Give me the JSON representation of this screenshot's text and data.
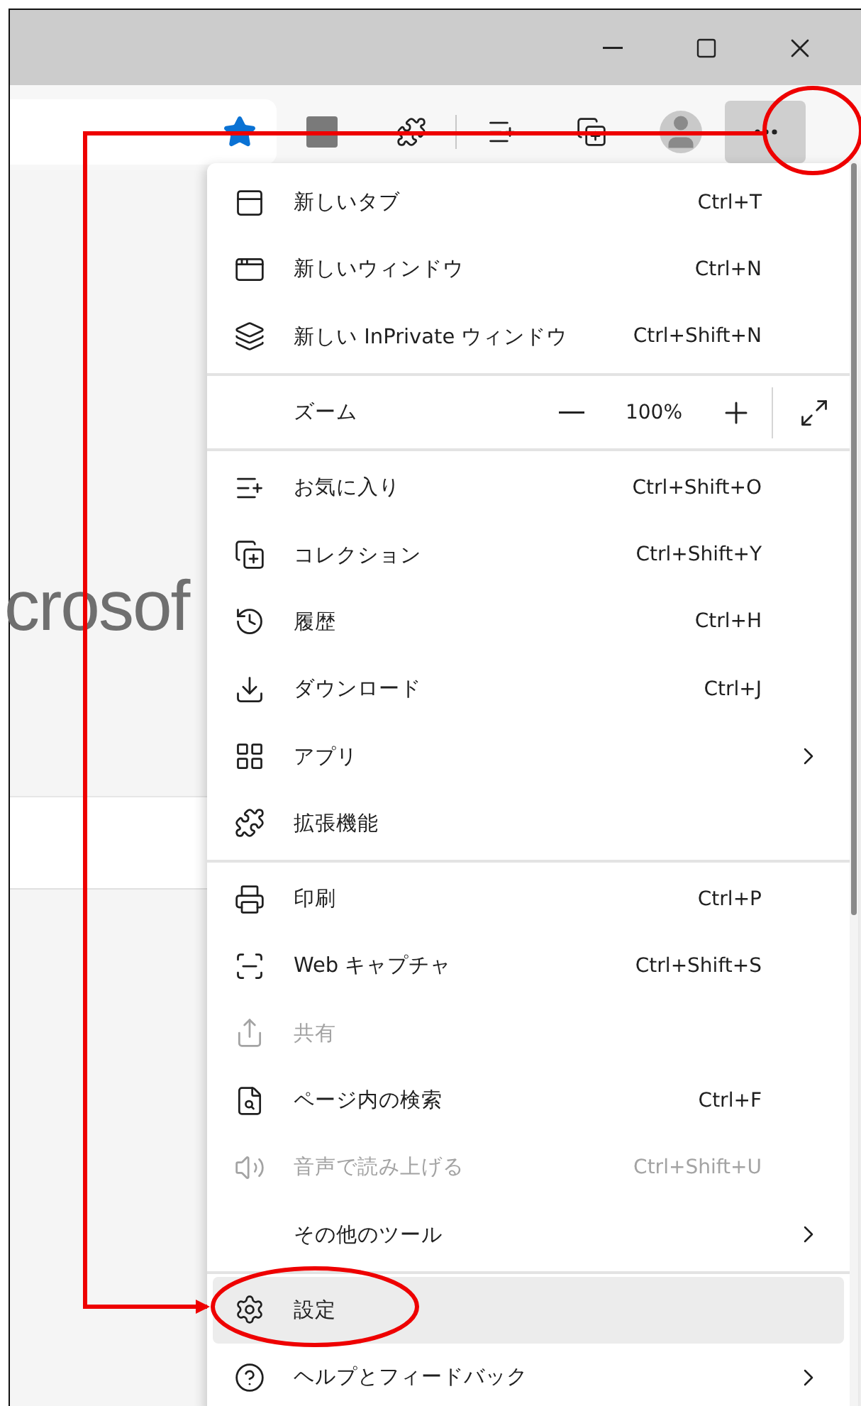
{
  "page": {
    "logo_fragment": "crosof"
  },
  "menu": {
    "groups": [
      {
        "items": [
          {
            "kind": "command",
            "label": "新しいタブ",
            "shortcut": "Ctrl+T",
            "disabled": false,
            "highlighted": false,
            "submenu": false
          },
          {
            "kind": "command",
            "label": "新しいウィンドウ",
            "shortcut": "Ctrl+N",
            "disabled": false,
            "highlighted": false,
            "submenu": false
          },
          {
            "kind": "command",
            "label": "新しい InPrivate ウィンドウ",
            "shortcut": "Ctrl+Shift+N",
            "disabled": false,
            "highlighted": false,
            "submenu": false
          }
        ]
      },
      {
        "items": [
          {
            "kind": "zoom",
            "label": "ズーム",
            "value": "100%"
          }
        ]
      },
      {
        "items": [
          {
            "kind": "command",
            "label": "お気に入り",
            "shortcut": "Ctrl+Shift+O",
            "disabled": false,
            "highlighted": false,
            "submenu": false
          },
          {
            "kind": "command",
            "label": "コレクション",
            "shortcut": "Ctrl+Shift+Y",
            "disabled": false,
            "highlighted": false,
            "submenu": false
          },
          {
            "kind": "command",
            "label": "履歴",
            "shortcut": "Ctrl+H",
            "disabled": false,
            "highlighted": false,
            "submenu": false
          },
          {
            "kind": "command",
            "label": "ダウンロード",
            "shortcut": "Ctrl+J",
            "disabled": false,
            "highlighted": false,
            "submenu": false
          },
          {
            "kind": "command",
            "label": "アプリ",
            "disabled": false,
            "highlighted": false,
            "submenu": true
          },
          {
            "kind": "command",
            "label": "拡張機能",
            "disabled": false,
            "highlighted": false,
            "submenu": false
          }
        ]
      },
      {
        "items": [
          {
            "kind": "command",
            "label": "印刷",
            "shortcut": "Ctrl+P",
            "disabled": false,
            "highlighted": false,
            "submenu": false
          },
          {
            "kind": "command",
            "label": "Web キャプチャ",
            "shortcut": "Ctrl+Shift+S",
            "disabled": false,
            "highlighted": false,
            "submenu": false
          },
          {
            "kind": "command",
            "label": "共有",
            "disabled": true,
            "highlighted": false,
            "submenu": false
          },
          {
            "kind": "command",
            "label": "ページ内の検索",
            "shortcut": "Ctrl+F",
            "disabled": false,
            "highlighted": false,
            "submenu": false
          },
          {
            "kind": "command",
            "label": "音声で読み上げる",
            "shortcut": "Ctrl+Shift+U",
            "disabled": true,
            "highlighted": false,
            "submenu": false
          },
          {
            "kind": "command",
            "label": "その他のツール",
            "disabled": false,
            "highlighted": false,
            "submenu": true
          }
        ]
      },
      {
        "items": [
          {
            "kind": "command",
            "label": "設定",
            "disabled": false,
            "highlighted": true,
            "submenu": false
          },
          {
            "kind": "command",
            "label": "ヘルプとフィードバック",
            "disabled": false,
            "highlighted": false,
            "submenu": true
          }
        ]
      }
    ]
  }
}
